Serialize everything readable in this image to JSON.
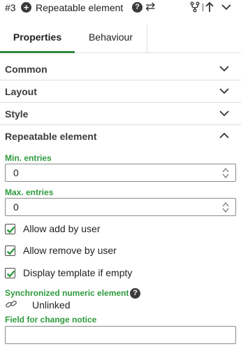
{
  "header": {
    "element_id": "#3",
    "add_icon": "plus-circle-icon",
    "title": "Repeatable element",
    "help_icon": "help-circle-icon",
    "swap_icon": "swap-arrows-icon",
    "fork_icon": "fork-icon",
    "up_icon": "arrow-up-icon",
    "menu_icon": "chevron-down-icon"
  },
  "tabs": [
    {
      "label": "Properties",
      "active": true
    },
    {
      "label": "Behaviour",
      "active": false
    }
  ],
  "sections": [
    {
      "label": "Common",
      "expanded": false
    },
    {
      "label": "Layout",
      "expanded": false
    },
    {
      "label": "Style",
      "expanded": false
    },
    {
      "label": "Repeatable element",
      "expanded": true
    }
  ],
  "repeatable": {
    "min_entries": {
      "label": "Min. entries",
      "value": "0"
    },
    "max_entries": {
      "label": "Max. entries",
      "value": "0"
    },
    "checkboxes": [
      {
        "label": "Allow add by user",
        "checked": true
      },
      {
        "label": "Allow remove by user",
        "checked": true
      },
      {
        "label": "Display template if empty",
        "checked": true
      }
    ],
    "sync_label": "Synchronized numeric element",
    "sync_status": "Unlinked",
    "change_notice_label": "Field for change notice",
    "change_notice_value": ""
  },
  "colors": {
    "accent_green": "#2e9b3d",
    "tab_underline": "#2e8b3d",
    "text": "#202124"
  }
}
